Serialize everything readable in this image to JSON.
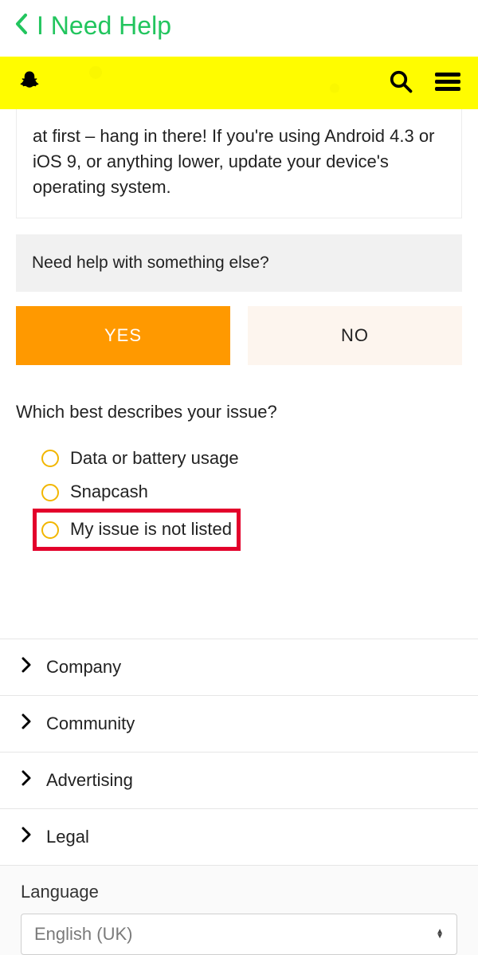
{
  "nav": {
    "title": "I Need Help"
  },
  "article": {
    "text_fragment": "at first – hang in there! If you're using Android 4.3 or iOS 9, or anything lower, update your device's operating system."
  },
  "help_else": {
    "prompt": "Need help with something else?"
  },
  "buttons": {
    "yes": "YES",
    "no": "NO"
  },
  "question": "Which best describes your issue?",
  "options": [
    {
      "label": "Data or battery usage"
    },
    {
      "label": "Snapcash"
    },
    {
      "label": "My issue is not listed"
    }
  ],
  "footer": {
    "links": [
      {
        "label": "Company"
      },
      {
        "label": "Community"
      },
      {
        "label": "Advertising"
      },
      {
        "label": "Legal"
      }
    ],
    "language_label": "Language",
    "language_value": "English (UK)"
  }
}
